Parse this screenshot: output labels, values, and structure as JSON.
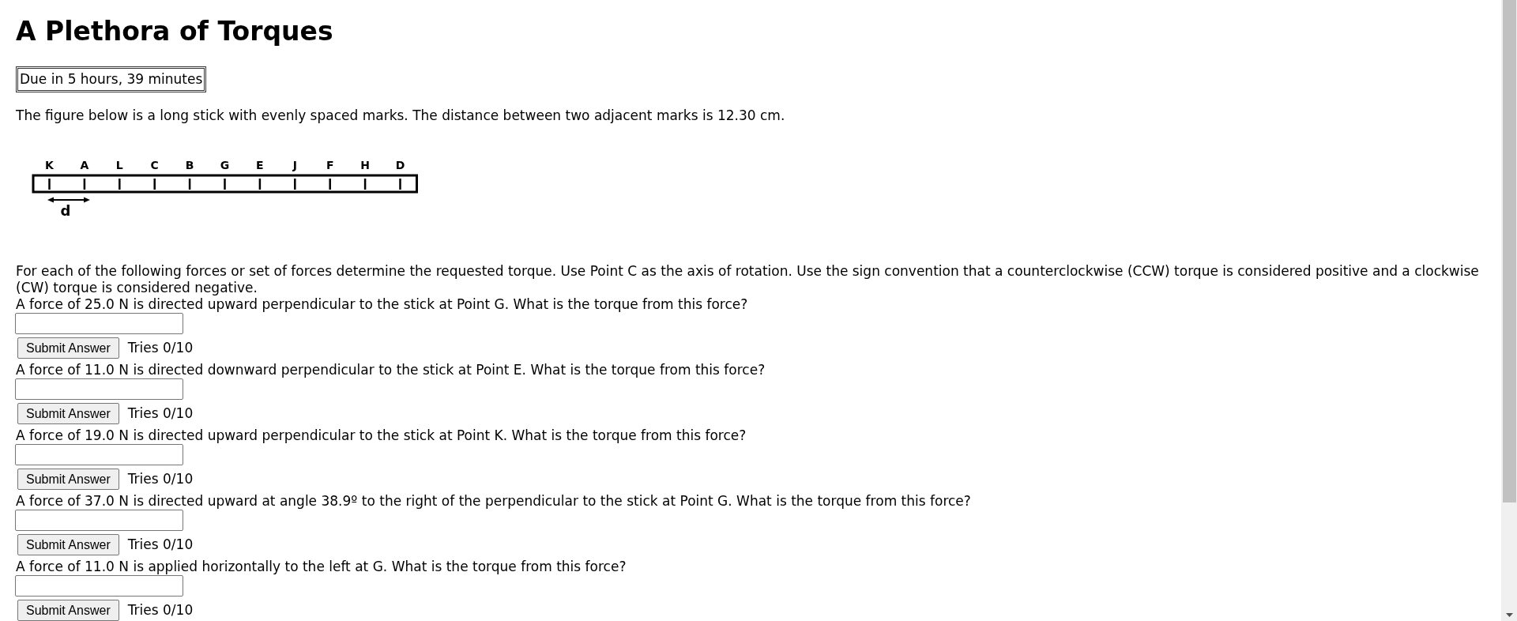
{
  "title": "A Plethora of Torques",
  "due": "Due in 5 hours, 39 minutes",
  "intro": "The figure below is a long stick with evenly spaced marks. The distance between two adjacent marks is 12.30 cm.",
  "figure": {
    "point_labels": [
      "K",
      "A",
      "L",
      "C",
      "B",
      "G",
      "E",
      "J",
      "F",
      "H",
      "D"
    ],
    "spacing_label": "d"
  },
  "instructions": "For each of the following forces or set of forces determine the requested torque. Use Point C as the axis of rotation. Use the sign convention that a counterclockwise (CCW) torque is considered positive and a clockwise (CW) torque is considered negative.",
  "questions": [
    {
      "text": "A force of 25.0 N is directed upward perpendicular to the stick at Point G. What is the torque from this force?",
      "button": "Submit Answer",
      "tries": "Tries 0/10"
    },
    {
      "text": "A force of 11.0 N is directed downward perpendicular to the stick at Point E. What is the torque from this force?",
      "button": "Submit Answer",
      "tries": "Tries 0/10"
    },
    {
      "text": "A force of 19.0 N is directed upward perpendicular to the stick at Point K. What is the torque from this force?",
      "button": "Submit Answer",
      "tries": "Tries 0/10"
    },
    {
      "text": "A force of 37.0 N is directed upward at angle 38.9º to the right of the perpendicular to the stick at Point G. What is the torque from this force?",
      "button": "Submit Answer",
      "tries": "Tries 0/10"
    },
    {
      "text": "A force of 11.0 N is applied horizontally to the left at G. What is the torque from this force?",
      "button": "Submit Answer",
      "tries": "Tries 0/10"
    }
  ]
}
